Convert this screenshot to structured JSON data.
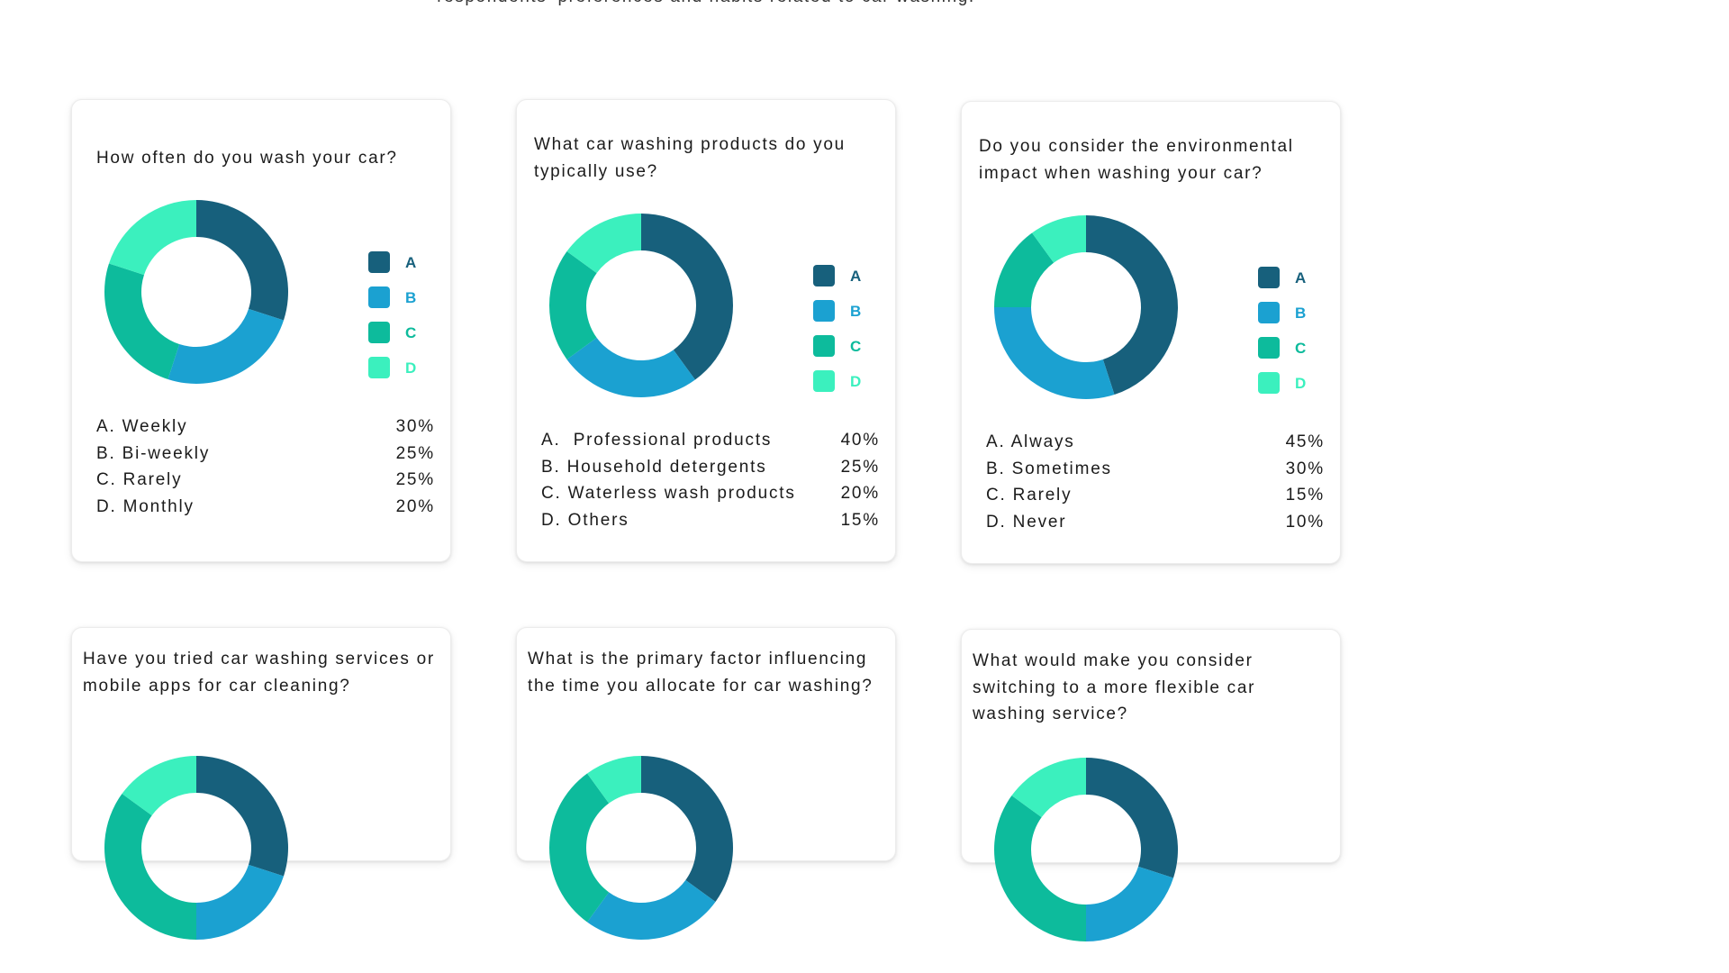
{
  "intro_text": "respondents' preferences and habits related to car washing.",
  "colors": {
    "A": "#17607c",
    "B": "#1ba1d1",
    "C": "#0dbb9c",
    "D": "#3bf0be"
  },
  "legend_keys": [
    "A",
    "B",
    "C",
    "D"
  ],
  "cards": [
    {
      "question": "How often do you wash your car?",
      "answers": [
        {
          "text": "A. Weekly",
          "value": "30%"
        },
        {
          "text": "B. Bi-weekly",
          "value": "25%"
        },
        {
          "text": "C. Rarely",
          "value": "25%"
        },
        {
          "text": "D. Monthly",
          "value": "20%"
        }
      ]
    },
    {
      "question": "What car washing products do you typically use?",
      "answers": [
        {
          "text": "A.  Professional products",
          "value": "40%"
        },
        {
          "text": "B. Household detergents",
          "value": "25%"
        },
        {
          "text": "C. Waterless wash products",
          "value": "20%"
        },
        {
          "text": "D. Others",
          "value": "15%"
        }
      ]
    },
    {
      "question": "Do you consider the environmental impact when washing your car?",
      "answers": [
        {
          "text": "A. Always",
          "value": "45%"
        },
        {
          "text": "B. Sometimes",
          "value": "30%"
        },
        {
          "text": "C. Rarely",
          "value": "15%"
        },
        {
          "text": "D. Never",
          "value": "10%"
        }
      ]
    },
    {
      "question": "Have you tried car washing services or mobile apps for car cleaning?",
      "answers": []
    },
    {
      "question": "What is the primary factor influencing the time you allocate for car washing?",
      "answers": []
    },
    {
      "question": "What would make you consider switching to a more flexible car washing service?",
      "answers": []
    }
  ],
  "chart_data": [
    {
      "type": "pie",
      "categories": [
        "A",
        "B",
        "C",
        "D"
      ],
      "values": [
        30,
        25,
        25,
        20
      ],
      "title": "How often do you wash your car?"
    },
    {
      "type": "pie",
      "categories": [
        "A",
        "B",
        "C",
        "D"
      ],
      "values": [
        40,
        25,
        20,
        15
      ],
      "title": "What car washing products do you typically use?"
    },
    {
      "type": "pie",
      "categories": [
        "A",
        "B",
        "C",
        "D"
      ],
      "values": [
        45,
        30,
        15,
        10
      ],
      "title": "Do you consider the environmental impact when washing your car?"
    },
    {
      "type": "pie",
      "categories": [
        "A",
        "B",
        "C",
        "D"
      ],
      "values": [
        30,
        20,
        35,
        15
      ],
      "title": "Have you tried car washing services or mobile apps for car cleaning?"
    },
    {
      "type": "pie",
      "categories": [
        "A",
        "B",
        "C",
        "D"
      ],
      "values": [
        35,
        25,
        30,
        10
      ],
      "title": "What is the primary factor influencing the time you allocate for car washing?"
    },
    {
      "type": "pie",
      "categories": [
        "A",
        "B",
        "C",
        "D"
      ],
      "values": [
        30,
        20,
        35,
        15
      ],
      "title": "What would make you consider switching to a more flexible car washing service?"
    }
  ]
}
